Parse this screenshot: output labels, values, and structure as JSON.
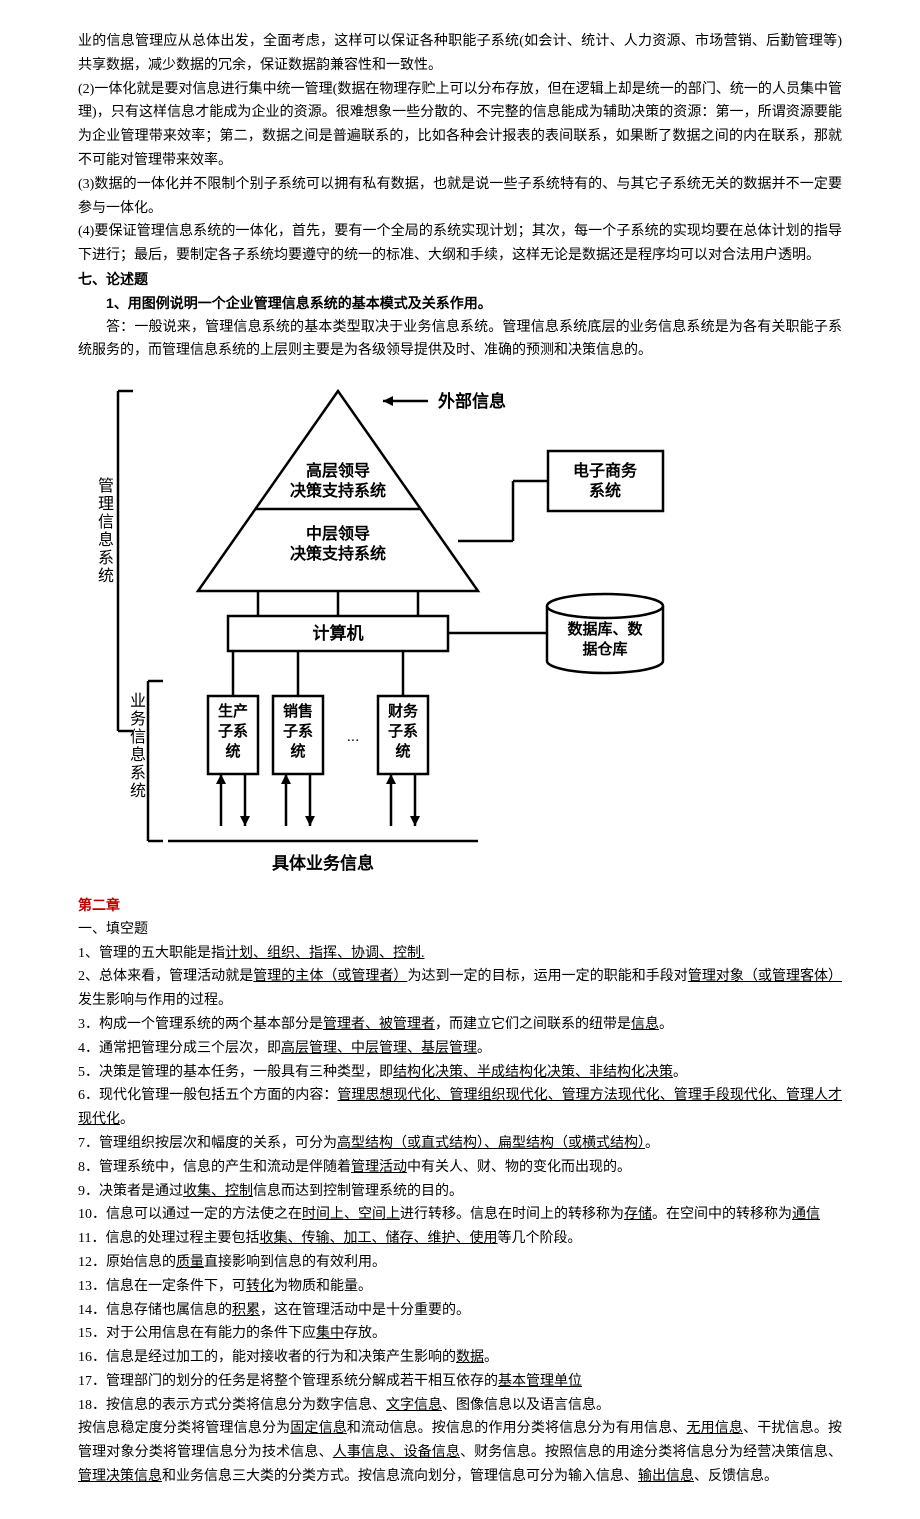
{
  "intro": {
    "p0": "业的信息管理应从总体出发，全面考虑，这样可以保证各种职能子系统(如会计、统计、人力资源、市场营销、后勤管理等)共享数据，减少数据的冗余，保证数据韵兼容性和一致性。",
    "p2": "(2)一体化就是要对信息进行集中统一管理(数据在物理存贮上可以分布存放，但在逻辑上却是统一的部门、统一的人员集中管理)，只有这样信息才能成为企业的资源。很难想象一些分散的、不完整的信息能成为辅助决策的资源：第一，所谓资源要能为企业管理带来效率；第二，数据之间是普遍联系的，比如各种会计报表的表间联系，如果断了数据之间的内在联系，那就不可能对管理带来效率。",
    "p3": "(3)数据的一体化并不限制个别子系统可以拥有私有数据，也就是说一些子系统特有的、与其它子系统无关的数据并不一定要参与一体化。",
    "p4": "(4)要保证管理信息系统的一体化，首先，要有一个全局的系统实现计划；其次，每一个子系统的实现均要在总体计划的指导下进行；最后，要制定各子系统均要遵守的统一的标准、大纲和手续，这样无论是数据还是程序均可以对合法用户透明。"
  },
  "section7": {
    "heading": "七、论述题",
    "q1": "1、用图例说明一个企业管理信息系统的基本模式及关系作用。",
    "a1": "答：一般说来，管理信息系统的基本类型取决于业务信息系统。管理信息系统底层的业务信息系统是为各有关职能子系统服务的，而管理信息系统的上层则主要是为各级领导提供及时、准确的预测和决策信息的。"
  },
  "diagram": {
    "external_info": "外部信息",
    "top_leader": "高层领导",
    "top_dss": "决策支持系统",
    "mid_leader": "中层领导",
    "mid_dss": "决策支持系统",
    "ecommerce1": "电子商务",
    "ecommerce2": "系统",
    "computer": "计算机",
    "db1": "数据库、数",
    "db2": "据仓库",
    "sub1a": "生产",
    "sub1b": "子系",
    "sub1c": "统",
    "sub2a": "销售",
    "sub2b": "子系",
    "sub2c": "统",
    "sub3": "...",
    "sub4a": "财务",
    "sub4b": "子系",
    "sub4c": "统",
    "left_label1": "管理信息系统",
    "left_label2": "业务信息系统",
    "bottom_label": "具体业务信息"
  },
  "chapter2": {
    "heading": "第二章",
    "fill_heading": "一、填空题",
    "items": [
      {
        "pre": "1、管理的五大职能是指",
        "u": "计划、组织、指挥、协调、控制."
      },
      {
        "pre": "2、总体来看，管理活动就是",
        "u": "管理的主体（或管理者）",
        "mid": "为达到一定的目标，运用一定的职能和手段对",
        "u2": "管理对象（或管理客体）",
        "post": "发生影响与作用的过程。"
      },
      {
        "pre": "3．构成一个管理系统的两个基本部分是",
        "u": "管理者、被管理者",
        "mid": "，而建立它们之间联系的纽带是",
        "u2": "信息",
        "post": "。"
      },
      {
        "pre": "4．通常把管理分成三个层次，即",
        "u": "高层管理、中层管理、基层管理",
        "post": "。"
      },
      {
        "pre": "5．决策是管理的基本任务，一般具有三种类型，即",
        "u": "结构化决策、半成结构化决策、非结构化决策",
        "post": "。"
      },
      {
        "pre": "6．现代化管理一般包括五个方面的内容：",
        "u": "管理思想现代化、管理组织现代化、管理方法现代化、管理手段现代化、管理人才现代化",
        "post": "。"
      },
      {
        "pre": "7．管理组织按层次和幅度的关系，可分为",
        "u": "高型结构（或直式结构）、扁型结构（或横式结构）",
        "post": "。"
      },
      {
        "pre": "8．管理系统中，信息的产生和流动是伴随着",
        "u": "管理活动",
        "post": "中有关人、财、物的变化而出现的。"
      },
      {
        "pre": "9．决策者是通过",
        "u": "收集、控制",
        "post": "信息而达到控制管理系统的目的。"
      },
      {
        "pre": "10．信息可以通过一定的方法使之在",
        "u": "时间上、空间上",
        "mid": "进行转移。信息在时间上的转移称为",
        "u2": "存储",
        "mid2": "。在空间中的转移称为",
        "u3": "通信"
      },
      {
        "pre": "11．信息的处理过程主要包括",
        "u": "收集、传输、加工、储存、维护、使用",
        "post": "等几个阶段。"
      },
      {
        "pre": "12．原始信息的",
        "u": "质量",
        "post": "直接影响到信息的有效利用。"
      },
      {
        "pre": "13．信息在一定条件下，可",
        "u": "转化",
        "post": "为物质和能量。"
      },
      {
        "pre": "14．信息存储也属信息的",
        "u": "积累",
        "post": "，这在管理活动中是十分重要的。"
      },
      {
        "pre": "15．对于公用信息在有能力的条件下应",
        "u": "集中",
        "post": "存放。"
      },
      {
        "pre": "16．信息是经过加工的，能对接收者的行为和决策产生影响的",
        "u": "数据",
        "post": "。"
      },
      {
        "pre": "17．管理部门的划分的任务是将整个管理系统分解成若干相互依存的",
        "u": "基本管理单位"
      },
      {
        "pre": "18．按信息的表示方式分类将信息分为数字信息、",
        "u": "文字信息",
        "post": "、图像信息以及语言信息。"
      }
    ],
    "tail": {
      "t1": "按信息稳定度分类将管理信息分为",
      "u1": "固定信息",
      "t2": "和流动信息。按信息的作用分类将信息分为有用信息、",
      "u2": "无用信息",
      "t3": "、干扰信息。按管理对象分类将管理信息分为技术信息、",
      "u3": "人事信息、设备信息",
      "t4": "、财务信息。按照信息的用途分类将信息分为经营决策信息、",
      "u4": "管理决策信息",
      "t5": "和业务信息三大类的分类方式。按信息流向划分，管理信息可分为输入信息、",
      "u5": "输出信息",
      "t6": "、反馈信息。"
    }
  }
}
